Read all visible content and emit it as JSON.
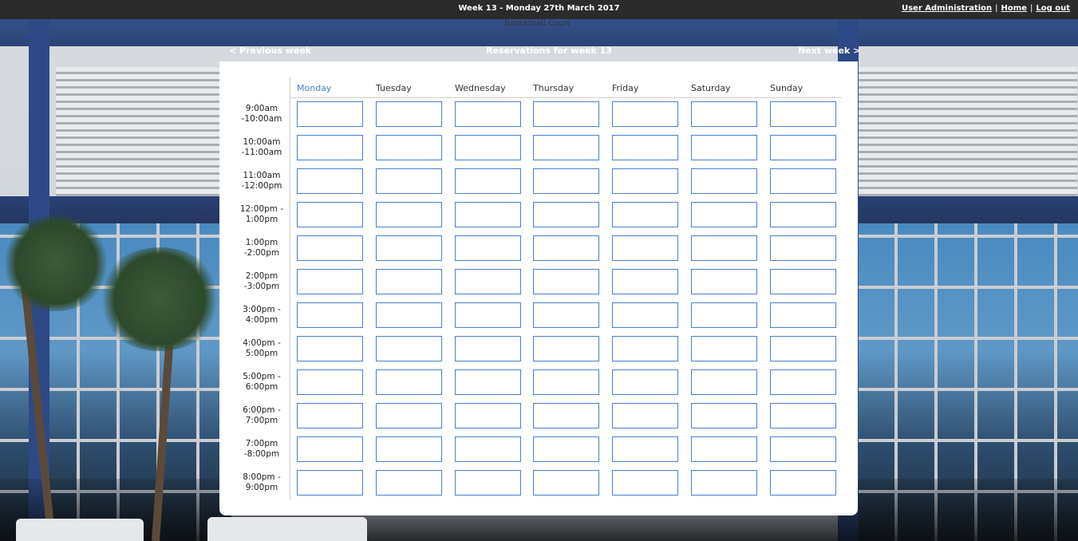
{
  "header": {
    "title": "Week 13 - Monday 27th March 2017",
    "links": [
      "User Administration",
      "Home",
      "Log out"
    ],
    "separator": "|"
  },
  "subtitle": "Basketball Court",
  "week_nav": {
    "previous": "< Previous week",
    "current": "Reservations for week 13",
    "next": "Next week >"
  },
  "calendar": {
    "selected_day": "Monday",
    "days": [
      "Monday",
      "Tuesday",
      "Wednesday",
      "Thursday",
      "Friday",
      "Saturday",
      "Sunday"
    ],
    "time_slots": [
      [
        "9:00am",
        "-10:00am"
      ],
      [
        "10:00am",
        "-11:00am"
      ],
      [
        "11:00am",
        "-12:00pm"
      ],
      [
        "12:00pm -",
        "1:00pm"
      ],
      [
        "1:00pm",
        "-2:00pm"
      ],
      [
        "2:00pm",
        "-3:00pm"
      ],
      [
        "3:00pm -",
        "4:00pm"
      ],
      [
        "4:00pm -",
        "5:00pm"
      ],
      [
        "5:00pm -",
        "6:00pm"
      ],
      [
        "6:00pm -",
        "7:00pm"
      ],
      [
        "7:00pm",
        "-8:00pm"
      ],
      [
        "8:00pm -",
        "9:00pm"
      ]
    ]
  },
  "colors": {
    "topbar": "#2b2b2b",
    "accent": "#4a7fd0",
    "card": "#ffffff"
  }
}
